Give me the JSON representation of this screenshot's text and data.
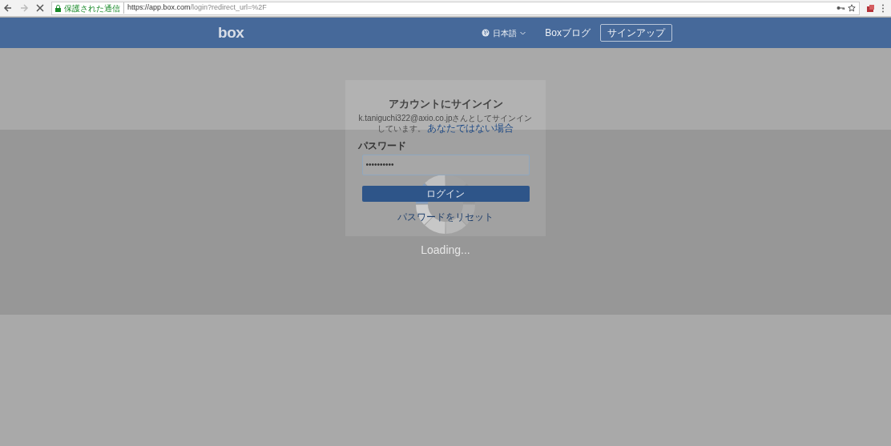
{
  "browser": {
    "secure_label": "保護された通信",
    "url_host": "https://app.box.com",
    "url_path": "/login?redirect_url=%2F",
    "loading": true
  },
  "header": {
    "logo": "box",
    "language": "日本語",
    "links": [
      "Boxブログ"
    ],
    "signup": "サインアップ"
  },
  "login": {
    "title": "アカウントにサインイン",
    "signed_in_as": "k.taniguchi322@axio.co.jpさんとしてサインインしています。",
    "not_you_link": "あなたではない場合",
    "password_label": "パスワード",
    "password_value": "••••••••••",
    "login_button": "ログイン",
    "reset_link": "パスワードをリセット"
  },
  "overlay": {
    "text": "Loading..."
  }
}
